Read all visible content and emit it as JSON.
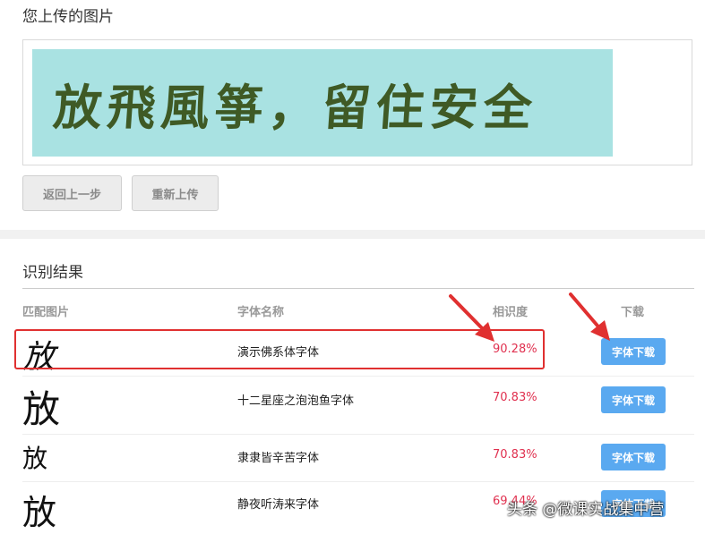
{
  "upload": {
    "title": "您上传的图片",
    "preview_text": "放飛風箏，留住安全",
    "preview_bg": "#a9e2e2",
    "preview_text_color": "#3f5a25"
  },
  "buttons": {
    "back": "返回上一步",
    "reupload": "重新上传"
  },
  "results": {
    "title": "识别结果",
    "headers": {
      "match": "匹配图片",
      "name": "字体名称",
      "similarity": "相识度",
      "download": "下载"
    },
    "rows": [
      {
        "glyph": "放",
        "name": "演示佛系体字体",
        "similarity": "90.28%",
        "download": "字体下载"
      },
      {
        "glyph": "放",
        "name": "十二星座之泡泡鱼字体",
        "similarity": "70.83%",
        "download": "字体下载"
      },
      {
        "glyph": "放",
        "name": "隶隶皆辛苦字体",
        "similarity": "70.83%",
        "download": "字体下载"
      },
      {
        "glyph": "放",
        "name": "静夜听涛来字体",
        "similarity": "69.44%",
        "download": "字体下载"
      }
    ]
  },
  "colors": {
    "score": "#e0304f",
    "download_button": "#5aa9f0",
    "annotation": "#e03030"
  },
  "watermark": "头条 @微课实战集中营"
}
